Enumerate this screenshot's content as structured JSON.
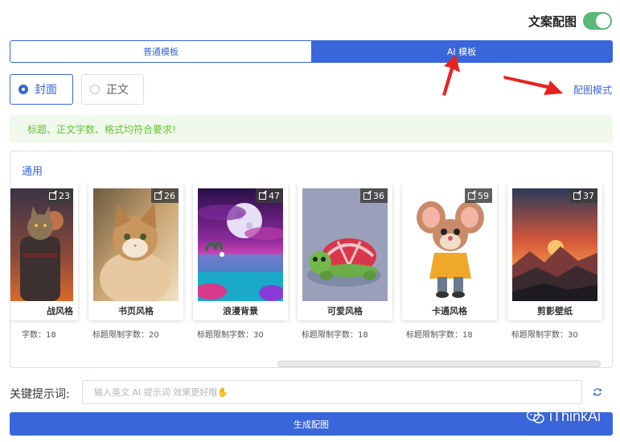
{
  "header": {
    "title": "文案配图",
    "toggle_on": true
  },
  "tabs": [
    {
      "label": "普通模板",
      "active": false
    },
    {
      "label": "AI 模板",
      "active": true
    }
  ],
  "radios": [
    {
      "label": "封面",
      "checked": true
    },
    {
      "label": "正文",
      "checked": false
    }
  ],
  "mode_link": "配图模式",
  "alert": "标题、正文字数、格式均符合要求!",
  "section_title": "通用",
  "cards": [
    {
      "name": "战风格",
      "count": "23",
      "limit": "字数：18"
    },
    {
      "name": "书页风格",
      "count": "26",
      "limit": "标题限制字数：20"
    },
    {
      "name": "浪漫背景",
      "count": "47",
      "limit": "标题限制字数：30"
    },
    {
      "name": "可爱风格",
      "count": "36",
      "limit": "标题限制字数：18"
    },
    {
      "name": "卡通风格",
      "count": "59",
      "limit": "标题限制字数：18"
    },
    {
      "name": "剪影壁纸",
      "count": "37",
      "limit": "标题限制字数：30"
    }
  ],
  "keyword": {
    "label": "关键提示词:",
    "value": "",
    "placeholder": "输入英文 AI 提示词 效果更好哦✋"
  },
  "generate_label": "生成配图",
  "watermark": "iThinkAi",
  "colors": {
    "primary": "#3a66db",
    "success": "#67c23a",
    "toggle": "#5cb87a",
    "annotation": "#e8231f"
  }
}
